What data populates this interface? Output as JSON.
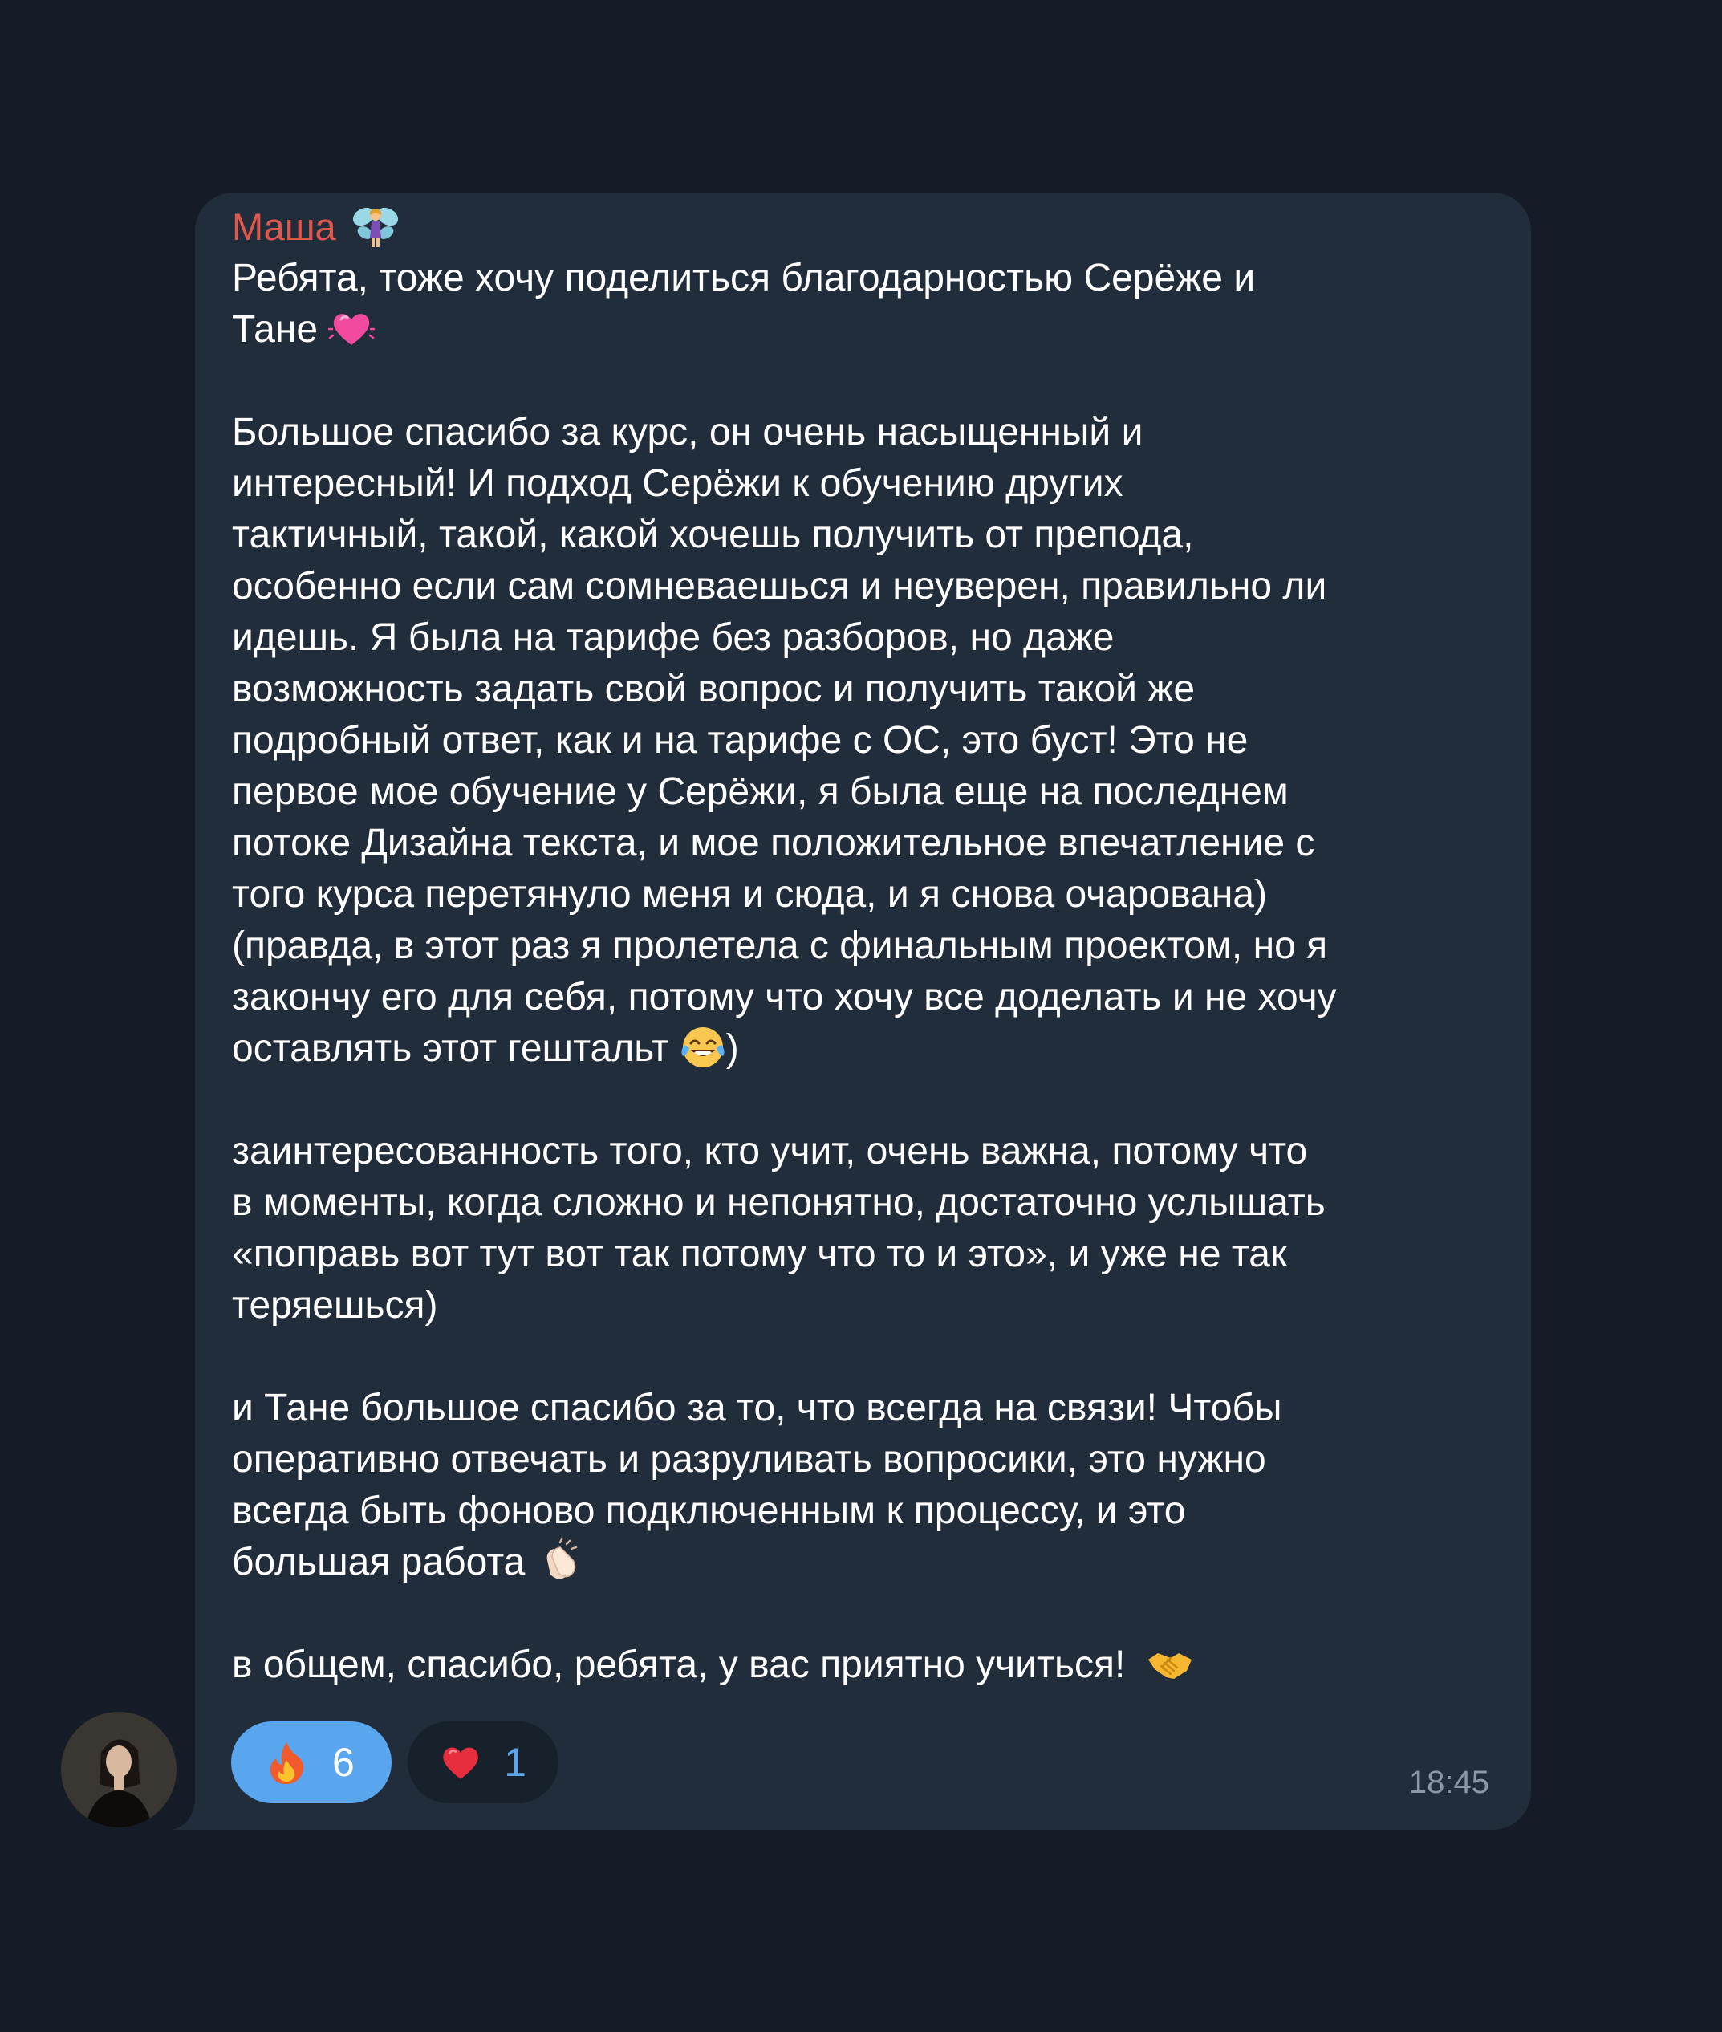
{
  "message": {
    "sender": "Маша",
    "sender_emoji": "fairy-emoji",
    "paragraphs": [
      [
        "Ребята, тоже хочу поделиться благодарностью Серёже и",
        "Тане"
      ],
      [
        "Большое спасибо за курс, он очень насыщенный и",
        "интересный! И подход Серёжи к обучению других",
        "тактичный, такой, какой хочешь получить от препода,",
        "особенно если сам сомневаешься и неуверен, правильно ли",
        "идешь. Я была на тарифе без разборов, но даже",
        "возможность задать свой вопрос и получить такой же",
        "подробный ответ, как и на тарифе с ОС, это буст! Это не",
        "первое мое обучение у Серёжи, я была еще на последнем",
        "потоке Дизайна текста, и мое положительное впечатление с",
        "того курса перетянуло меня и сюда, и я снова очарована)",
        "(правда, в этот раз я пролетела с финальным проектом, но я",
        "закончу его для себя, потому что хочу все доделать и не хочу",
        "оставлять этот гештальт",
        ")"
      ],
      [
        "заинтересованность того, кто учит, очень важна, потому что",
        "в моменты, когда сложно и непонятно, достаточно услышать",
        "«поправь вот тут вот так потому что то и это», и уже не так",
        "теряешься)"
      ],
      [
        "и Тане большое спасибо за то, что всегда на связи! Чтобы",
        "оперативно отвечать и разруливать вопросики, это нужно",
        "всегда быть фоново подключенным к процессу, и это",
        "большая работа"
      ],
      [
        "в общем, спасибо, ребята, у вас приятно учиться!"
      ]
    ],
    "inline_emojis": [
      "pink-heart-emoji",
      "tears-of-joy-emoji",
      "clapping-hands-emoji",
      "handshake-emoji"
    ],
    "time": "18:45"
  },
  "reactions": [
    {
      "emoji": "fire-emoji",
      "count": "6",
      "active": true
    },
    {
      "emoji": "red-heart-emoji",
      "count": "1",
      "active": false
    }
  ],
  "colors": {
    "background": "#161c27",
    "bubble": "#212d3b",
    "sender": "#e0574d",
    "text": "#ffffff",
    "accent": "#59a5ee",
    "time": "#8c97a5"
  }
}
